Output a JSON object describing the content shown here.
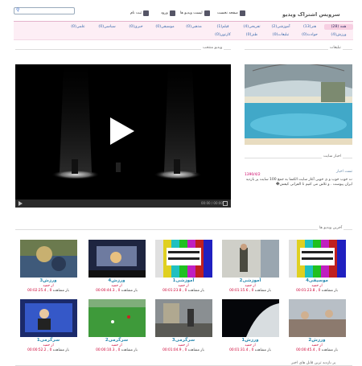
{
  "header": {
    "logo": "سرویس اشتراک ویدیو",
    "links": [
      {
        "label": "صفحه نخست"
      },
      {
        "label": "لیست ویدیو ها"
      },
      {
        "label": "ورود"
      },
      {
        "label": "ثبت نام"
      }
    ],
    "search_placeholder": ""
  },
  "categories": {
    "row1": [
      "همه (28)",
      "هنر(13)",
      "آموزشی(2)",
      "تفریحی(4)",
      "فیلم(1)",
      "مذهبی(0)",
      "موسیقی(0)",
      "خبری(0)",
      "سیاسی(0)",
      "علمی(0)"
    ],
    "row2": [
      "ورزش(4)",
      "حوادث(0)",
      "تبلیغات(0)",
      "طنز(0)",
      "کارتون(0)"
    ]
  },
  "sections": {
    "featured": "ویدیو منتخب",
    "ads": "تبلیغات",
    "news": "اخبار سایت",
    "latest": "آخرین ویدیو ها",
    "most_viewed": "پر بازدید ترین فایل های اخیر"
  },
  "player": {
    "time": "00:00 / 00:00"
  },
  "news": {
    "date": "1390/4/2",
    "title": "تست اخبار",
    "text": "ت خوب خوب و ی خوبی آغاز سایت الکسا به جمع 100 سایت پر بازدید ایران پیوست . و تلاش می کنیم تا الفراتی کیفش�"
  },
  "videos": [
    {
      "title": "ورزش3",
      "by": "از حمید",
      "views_label": "بار مشاهده",
      "views": "0",
      "duration": "00:02:25.4",
      "thumb": "thumb-sport-crowd"
    },
    {
      "title": "ورزش4",
      "by": "از حمید",
      "views_label": "بار مشاهده",
      "views": "0",
      "duration": "00:00:44.3",
      "thumb": "thumb-sport-night"
    },
    {
      "title": "آموزشی1",
      "by": "از حمید",
      "views_label": "بار مشاهده",
      "views": "0",
      "duration": "00:01:23.8",
      "thumb": "thumb-test-card"
    },
    {
      "title": "آموزشی2",
      "by": "از حمید",
      "views_label": "بار مشاهده",
      "views": "0",
      "duration": "00:01:15.6",
      "thumb": "thumb-person-room"
    },
    {
      "title": "موسیقی4",
      "by": "از حمید",
      "views_label": "بار مشاهده",
      "views": "0",
      "duration": "00:01:23.8",
      "thumb": "thumb-test-card"
    },
    {
      "title": "سرگرمی1",
      "by": "از حمید",
      "views_label": "بار مشاهده",
      "views": "0",
      "duration": "00:00:52.2",
      "thumb": "thumb-tv-show"
    },
    {
      "title": "سرگرمی2",
      "by": "از حمید",
      "views_label": "بار مشاهده",
      "views": "0",
      "duration": "00:00:10.3",
      "thumb": "thumb-soccer"
    },
    {
      "title": "سرگرمی3",
      "by": "از حمید",
      "views_label": "بار مشاهده",
      "views": "0",
      "duration": "00:01:04.9",
      "thumb": "thumb-street"
    },
    {
      "title": "ورزش1",
      "by": "از حمید",
      "views_label": "بار مشاهده",
      "views": "0",
      "duration": "00:01:31.4",
      "thumb": "thumb-planet"
    },
    {
      "title": "ورزش2",
      "by": "از حمید",
      "views_label": "بار مشاهده",
      "views": "0",
      "duration": "00:00:45.4",
      "thumb": "thumb-crowd-site"
    }
  ]
}
